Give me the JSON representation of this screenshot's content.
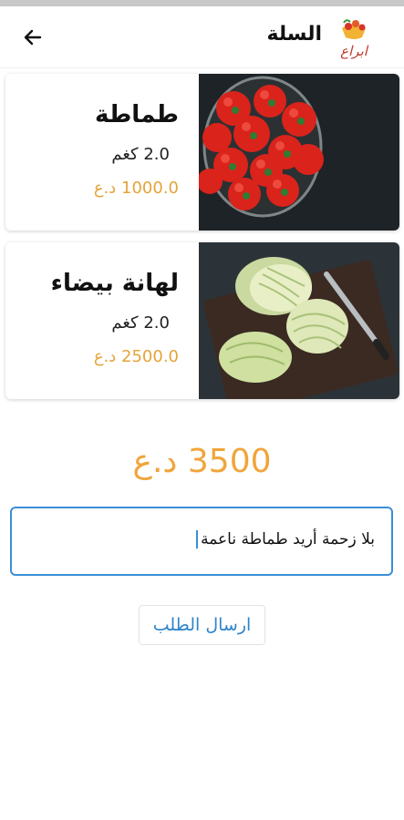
{
  "header": {
    "title": "السلة",
    "logo_text": "ابراع"
  },
  "cart": {
    "items": [
      {
        "name": "طماطة",
        "quantity": "2.0 كغم",
        "price": "1000.0 د.ع",
        "image": "tomatoes-photo"
      },
      {
        "name": "لهانة بيضاء",
        "quantity": "2.0 كغم",
        "price": "2500.0 د.ع",
        "image": "cabbage-photo"
      }
    ],
    "total": "3500 د.ع"
  },
  "notes": {
    "value": "بلا زحمة أريد طماطة ناعمة"
  },
  "actions": {
    "submit_label": "ارسال الطلب"
  },
  "colors": {
    "price": "#e5a43a",
    "accent": "#3b8fd6",
    "total": "#f0a53b"
  }
}
